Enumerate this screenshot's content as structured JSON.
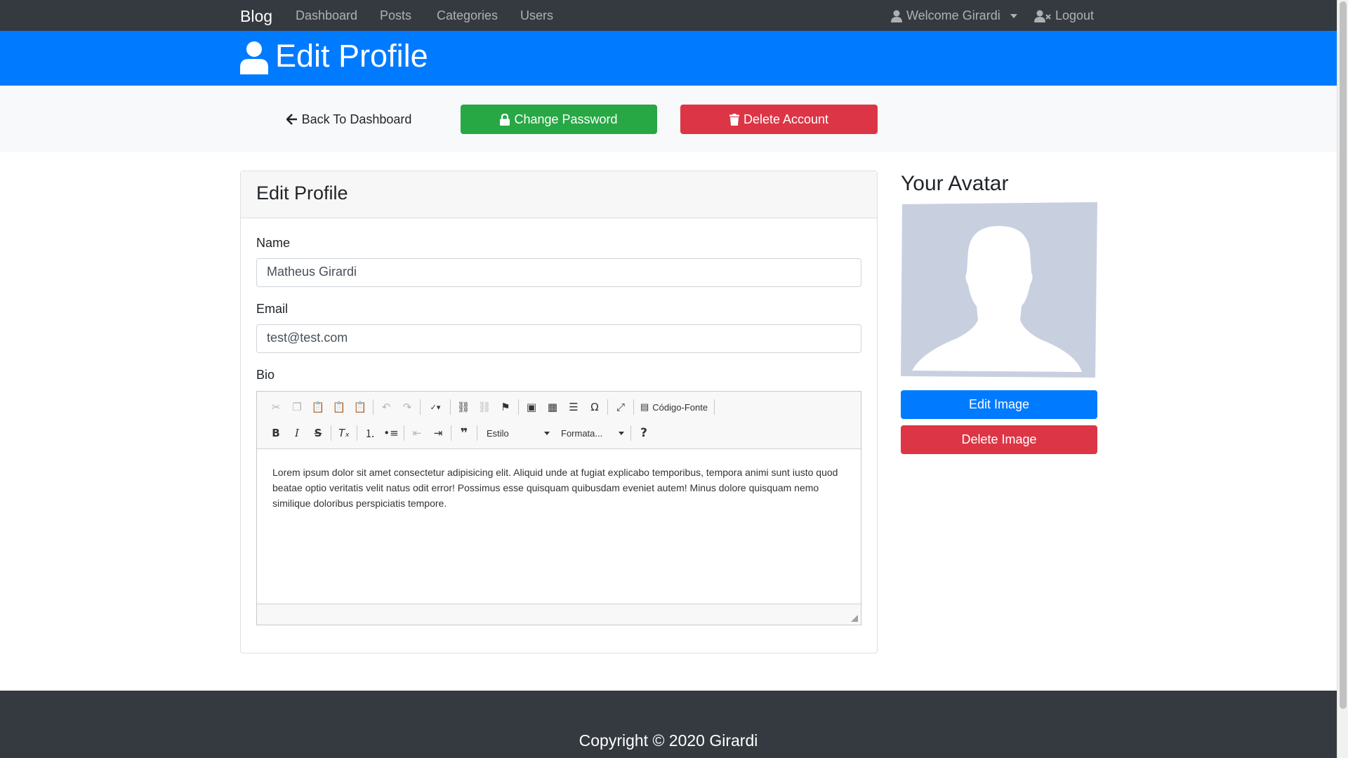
{
  "navbar": {
    "brand": "Blog",
    "links": [
      "Dashboard",
      "Posts",
      "Categories",
      "Users"
    ],
    "welcome": "Welcome Girardi",
    "logout": "Logout"
  },
  "header": {
    "title": "Edit Profile"
  },
  "actions": {
    "back": "Back To Dashboard",
    "change_password": "Change Password",
    "delete_account": "Delete Account"
  },
  "form": {
    "card_title": "Edit Profile",
    "name_label": "Name",
    "name_value": "Matheus Girardi",
    "email_label": "Email",
    "email_value": "test@test.com",
    "bio_label": "Bio",
    "bio_text": "Lorem ipsum dolor sit amet consectetur adipisicing elit. Aliquid unde at fugiat explicabo temporibus, tempora animi sunt iusto quod beatae optio veritatis velit natus odit error! Possimus esse quisquam quibusdam eveniet autem! Minus dolore quisquam nemo similique doloribus perspiciatis tempore."
  },
  "editor": {
    "source_label": "Código-Fonte",
    "style_combo": "Estilo",
    "format_combo": "Formata..."
  },
  "sidebar": {
    "title": "Your Avatar",
    "edit_image": "Edit Image",
    "delete_image": "Delete Image"
  },
  "footer": {
    "copyright": "Copyright © 2020 Girardi"
  },
  "colors": {
    "navbar": "#343a40",
    "primary": "#007bff",
    "success": "#28a745",
    "danger": "#dc3545",
    "light": "#f8f9fa"
  }
}
